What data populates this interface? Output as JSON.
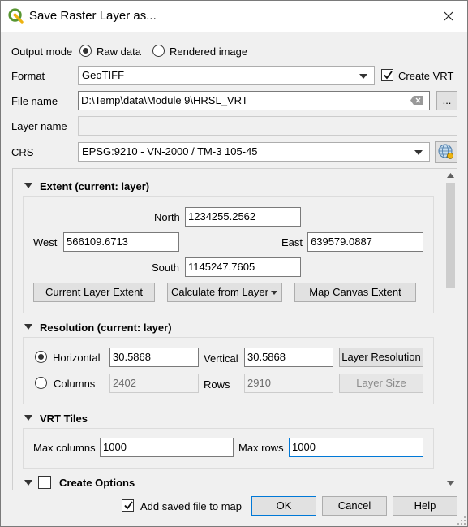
{
  "window": {
    "title": "Save Raster Layer as...",
    "accent": "#589632"
  },
  "output_mode": {
    "label": "Output mode",
    "options": [
      "Raw data",
      "Rendered image"
    ],
    "selected": "Raw data"
  },
  "format": {
    "label": "Format",
    "value": "GeoTIFF",
    "create_vrt_label": "Create VRT",
    "create_vrt_checked": true
  },
  "file_name": {
    "label": "File name",
    "value": "D:\\Temp\\data\\Module 9\\HRSL_VRT",
    "browse_label": "..."
  },
  "layer_name": {
    "label": "Layer name",
    "value": ""
  },
  "crs": {
    "label": "CRS",
    "value": "EPSG:9210 - VN-2000 / TM-3 105-45"
  },
  "extent": {
    "title": "Extent (current: layer)",
    "north_label": "North",
    "north": "1234255.2562",
    "west_label": "West",
    "west": "566109.6713",
    "east_label": "East",
    "east": "639579.0887",
    "south_label": "South",
    "south": "1145247.7605",
    "btn_current": "Current Layer Extent",
    "btn_calculate": "Calculate from Layer",
    "btn_canvas": "Map Canvas Extent"
  },
  "resolution": {
    "title": "Resolution (current: layer)",
    "horizontal_label": "Horizontal",
    "horizontal": "30.5868",
    "vertical_label": "Vertical",
    "vertical": "30.5868",
    "btn_layer_res": "Layer Resolution",
    "columns_label": "Columns",
    "columns": "2402",
    "rows_label": "Rows",
    "rows": "2910",
    "btn_layer_size": "Layer Size",
    "mode": "Horizontal"
  },
  "vrt_tiles": {
    "title": "VRT Tiles",
    "max_columns_label": "Max columns",
    "max_columns": "1000",
    "max_rows_label": "Max rows",
    "max_rows": "1000"
  },
  "create_options": {
    "title": "Create Options",
    "checked": false
  },
  "footer": {
    "add_to_map_label": "Add saved file to map",
    "add_to_map_checked": true,
    "ok": "OK",
    "cancel": "Cancel",
    "help": "Help"
  }
}
